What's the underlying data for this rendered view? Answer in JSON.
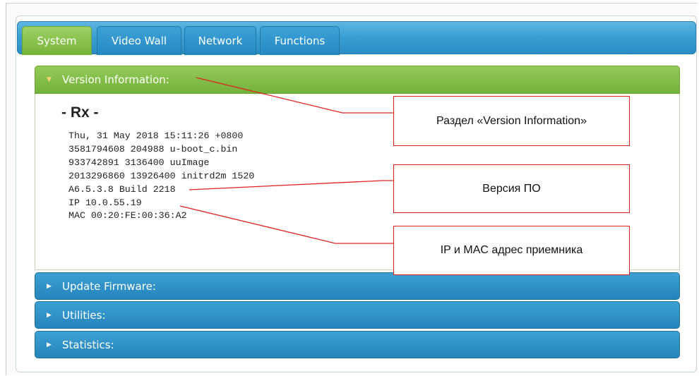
{
  "tabs": [
    {
      "label": "System",
      "active": true
    },
    {
      "label": "Video Wall",
      "active": false
    },
    {
      "label": "Network",
      "active": false
    },
    {
      "label": "Functions",
      "active": false
    }
  ],
  "sections": {
    "version": {
      "label": "Version Information:",
      "expanded": true
    },
    "firmware": {
      "label": "Update Firmware:",
      "expanded": false
    },
    "utilities": {
      "label": "Utilities:",
      "expanded": false
    },
    "statistics": {
      "label": "Statistics:",
      "expanded": false
    }
  },
  "version_info": {
    "title": "- Rx -",
    "lines": [
      "Thu, 31 May 2018 15:11:26 +0800",
      "3581794608 204988 u-boot_c.bin",
      "933742891 3136400 uuImage",
      "2013296860 13926400 initrd2m 1520",
      "A6.5.3.8 Build 2218",
      "IP 10.0.55.19",
      "MAC 00:20:FE:00:36:A2"
    ]
  },
  "annotations": {
    "section": "Раздел «Version Information»",
    "firmware_version": "Версия ПО",
    "ip_mac": "IP и MAC адрес приемника"
  },
  "colors": {
    "tab_active": "#76b43a",
    "tab_inactive": "#2489c2",
    "section_open": "#74b13a",
    "section_collapsed": "#2584bb",
    "callout_border": "#e02020"
  },
  "icons": {
    "expanded": "triangle-down-icon",
    "collapsed": "triangle-right-icon"
  }
}
